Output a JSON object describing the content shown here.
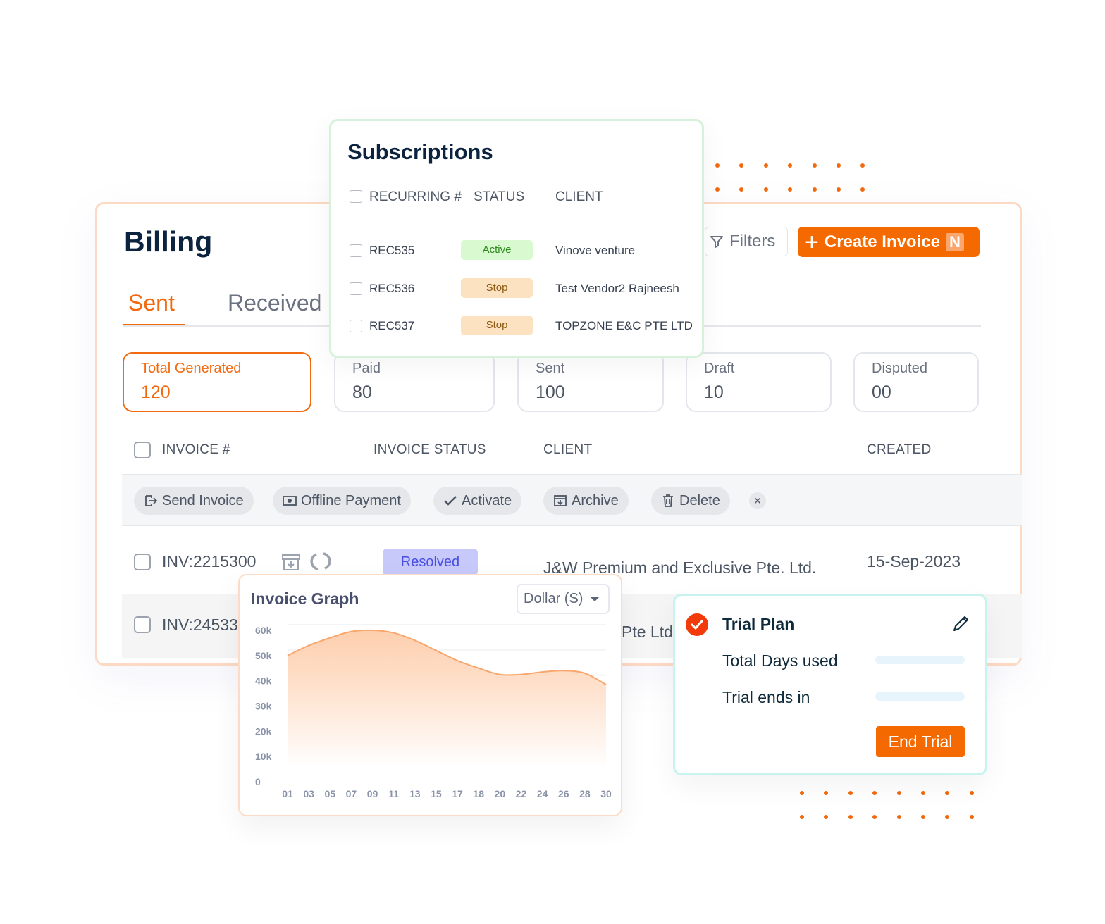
{
  "billing": {
    "title": "Billing",
    "tabs": [
      {
        "label": "Sent",
        "active": true
      },
      {
        "label": "Received",
        "active": false
      }
    ],
    "filters_label": "Filters",
    "create_label": "Create Invoice",
    "create_shortcut": "N",
    "stats": [
      {
        "label": "Total Generated",
        "value": "120"
      },
      {
        "label": "Paid",
        "value": "80"
      },
      {
        "label": "Sent",
        "value": "100"
      },
      {
        "label": "Draft",
        "value": "10"
      },
      {
        "label": "Disputed",
        "value": "00"
      }
    ],
    "columns": [
      "INVOICE #",
      "INVOICE STATUS",
      "CLIENT",
      "CREATED"
    ],
    "actions": [
      {
        "label": "Send Invoice",
        "icon": "send-icon"
      },
      {
        "label": "Offline Payment",
        "icon": "cash-icon"
      },
      {
        "label": "Activate",
        "icon": "check-icon"
      },
      {
        "label": "Archive",
        "icon": "archive-icon"
      },
      {
        "label": "Delete",
        "icon": "trash-icon"
      }
    ],
    "rows": [
      {
        "invoice": "INV:2215300",
        "status": "Resolved",
        "client": "J&W Premium and Exclusive Pte. Ltd.",
        "created": "15-Sep-2023"
      },
      {
        "invoice": "INV:24533",
        "client": "Pte Ltd"
      }
    ]
  },
  "subscriptions": {
    "title": "Subscriptions",
    "columns": [
      "RECURRING #",
      "STATUS",
      "CLIENT"
    ],
    "rows": [
      {
        "id": "REC535",
        "status": "Active",
        "client": "Vinove venture"
      },
      {
        "id": "REC536",
        "status": "Stop",
        "client": "Test Vendor2 Rajneesh"
      },
      {
        "id": "REC537",
        "status": "Stop",
        "client": "TOPZONE E&C PTE LTD"
      }
    ]
  },
  "graph": {
    "title": "Invoice Graph",
    "currency": "Dollar (S)"
  },
  "chart_data": {
    "type": "area",
    "x": [
      "01",
      "03",
      "05",
      "07",
      "09",
      "11",
      "13",
      "15",
      "17",
      "18",
      "20",
      "22",
      "24",
      "26",
      "28",
      "30"
    ],
    "values": [
      50000,
      54000,
      57000,
      59500,
      60000,
      59000,
      56000,
      52000,
      48000,
      45000,
      42500,
      42500,
      43500,
      44000,
      43000,
      38500
    ],
    "yticks": [
      "0",
      "10k",
      "20k",
      "30k",
      "40k",
      "50k",
      "60k"
    ],
    "ylim": [
      0,
      60000
    ],
    "grid": true,
    "color": "#f9a66c"
  },
  "trial": {
    "title": "Trial Plan",
    "rows": [
      "Total Days used",
      "Trial ends in"
    ],
    "end_label": "End Trial"
  },
  "colors": {
    "accent": "#f26a0f",
    "navy": "#0c2340",
    "resolved_bg": "#c7c9fb",
    "active_bg": "#d9f9d0",
    "stop_bg": "#fde2c2"
  }
}
